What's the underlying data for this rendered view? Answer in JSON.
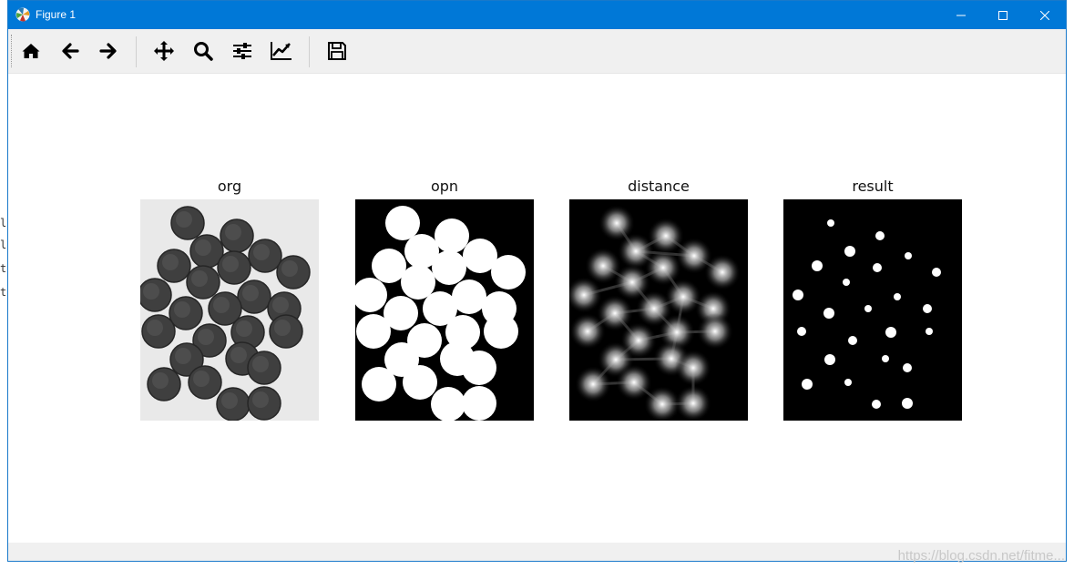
{
  "window": {
    "title": "Figure 1",
    "accent": "#0078d7"
  },
  "toolbar": {
    "buttons": [
      {
        "name": "home-icon"
      },
      {
        "name": "back-arrow-icon"
      },
      {
        "name": "forward-arrow-icon"
      },
      {
        "name": "pan-icon"
      },
      {
        "name": "zoom-icon"
      },
      {
        "name": "configure-subplots-icon"
      },
      {
        "name": "edit-axis-icon"
      },
      {
        "name": "save-icon"
      }
    ]
  },
  "figure": {
    "panels": [
      {
        "title": "org"
      },
      {
        "title": "opn"
      },
      {
        "title": "distance"
      },
      {
        "title": "result"
      }
    ]
  },
  "watermark": "https://blog.csdn.net/fitme..."
}
